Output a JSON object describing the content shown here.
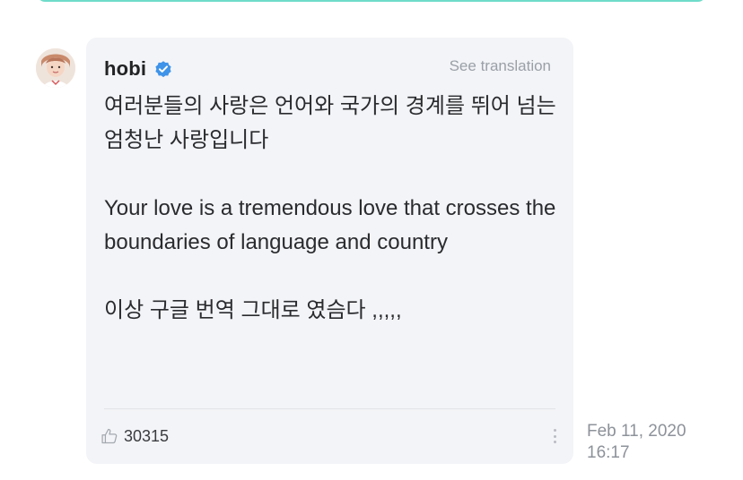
{
  "post": {
    "author": "hobi",
    "author_verified": true,
    "see_translation": "See translation",
    "body": [
      "여러분들의 사랑은 언어와 국가의 경계를 뛰어 넘는 엄청난 사랑입니다",
      "Your love is a tremendous love that crosses the boundaries of language and country",
      "이상 구글 번역 그대로 였슴다 ,,,,,"
    ],
    "like_count": "30315",
    "timestamp_date": "Feb 11, 2020",
    "timestamp_time": "16:17"
  },
  "icons": {
    "avatar": "avatar",
    "verified": "verified-badge-icon",
    "like": "thumbs-up-icon",
    "more": "more-vertical-icon"
  },
  "colors": {
    "bubble_bg": "#f3f4f7",
    "verified_blue": "#3f93e8",
    "accent_teal": "#6fdcc9",
    "muted_text": "#9aa0a8"
  }
}
